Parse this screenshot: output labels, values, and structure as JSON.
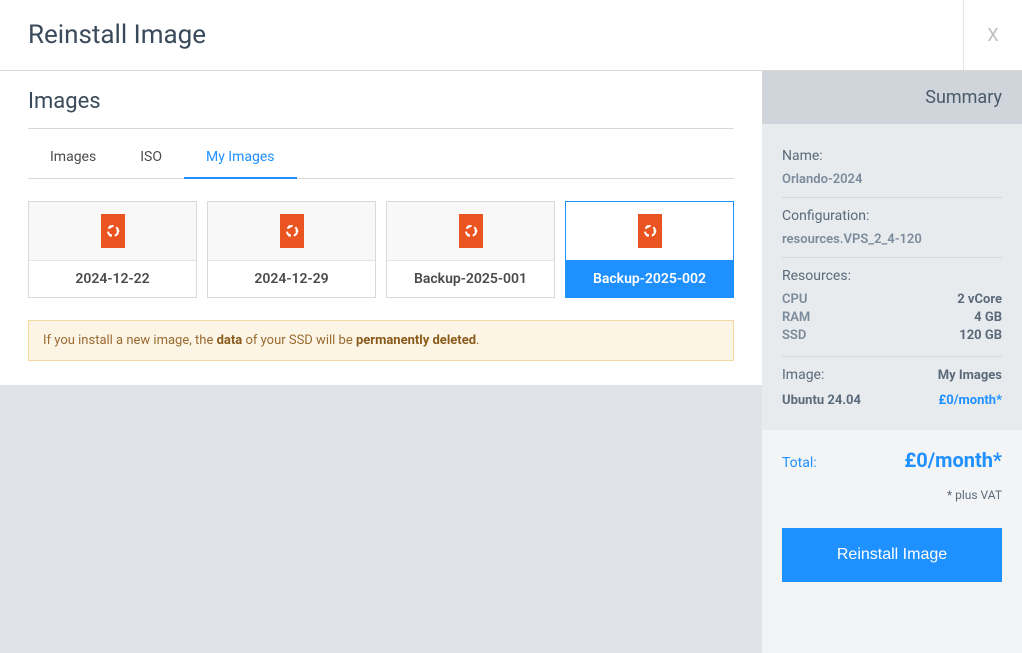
{
  "header": {
    "title": "Reinstall Image",
    "close": "X"
  },
  "main": {
    "section_title": "Images",
    "tabs": [
      {
        "label": "Images",
        "active": false
      },
      {
        "label": "ISO",
        "active": false
      },
      {
        "label": "My Images",
        "active": true
      }
    ],
    "cards": [
      {
        "label": "2024-12-22",
        "icon": "ubuntu-icon",
        "selected": false
      },
      {
        "label": "2024-12-29",
        "icon": "ubuntu-icon",
        "selected": false
      },
      {
        "label": "Backup-2025-001",
        "icon": "ubuntu-icon",
        "selected": false
      },
      {
        "label": "Backup-2025-002",
        "icon": "ubuntu-icon",
        "selected": true
      }
    ],
    "warning": {
      "pre": "If you install a new image, the ",
      "bold1": "data",
      "mid": " of your SSD will be ",
      "bold2": "permanently deleted",
      "post": "."
    }
  },
  "summary": {
    "heading": "Summary",
    "name_label": "Name:",
    "name_value": "Orlando-2024",
    "config_label": "Configuration:",
    "config_value": "resources.VPS_2_4-120",
    "resources_label": "Resources:",
    "resources": [
      {
        "k": "CPU",
        "v": "2 vCore"
      },
      {
        "k": "RAM",
        "v": "4 GB"
      },
      {
        "k": "SSD",
        "v": "120 GB"
      }
    ],
    "image_label": "Image:",
    "image_type": "My Images",
    "image_os": "Ubuntu 24.04",
    "image_price": "£0/month*",
    "total_label": "Total:",
    "total_value": "£0/month*",
    "vat_note": "* plus VAT",
    "button": "Reinstall Image"
  }
}
